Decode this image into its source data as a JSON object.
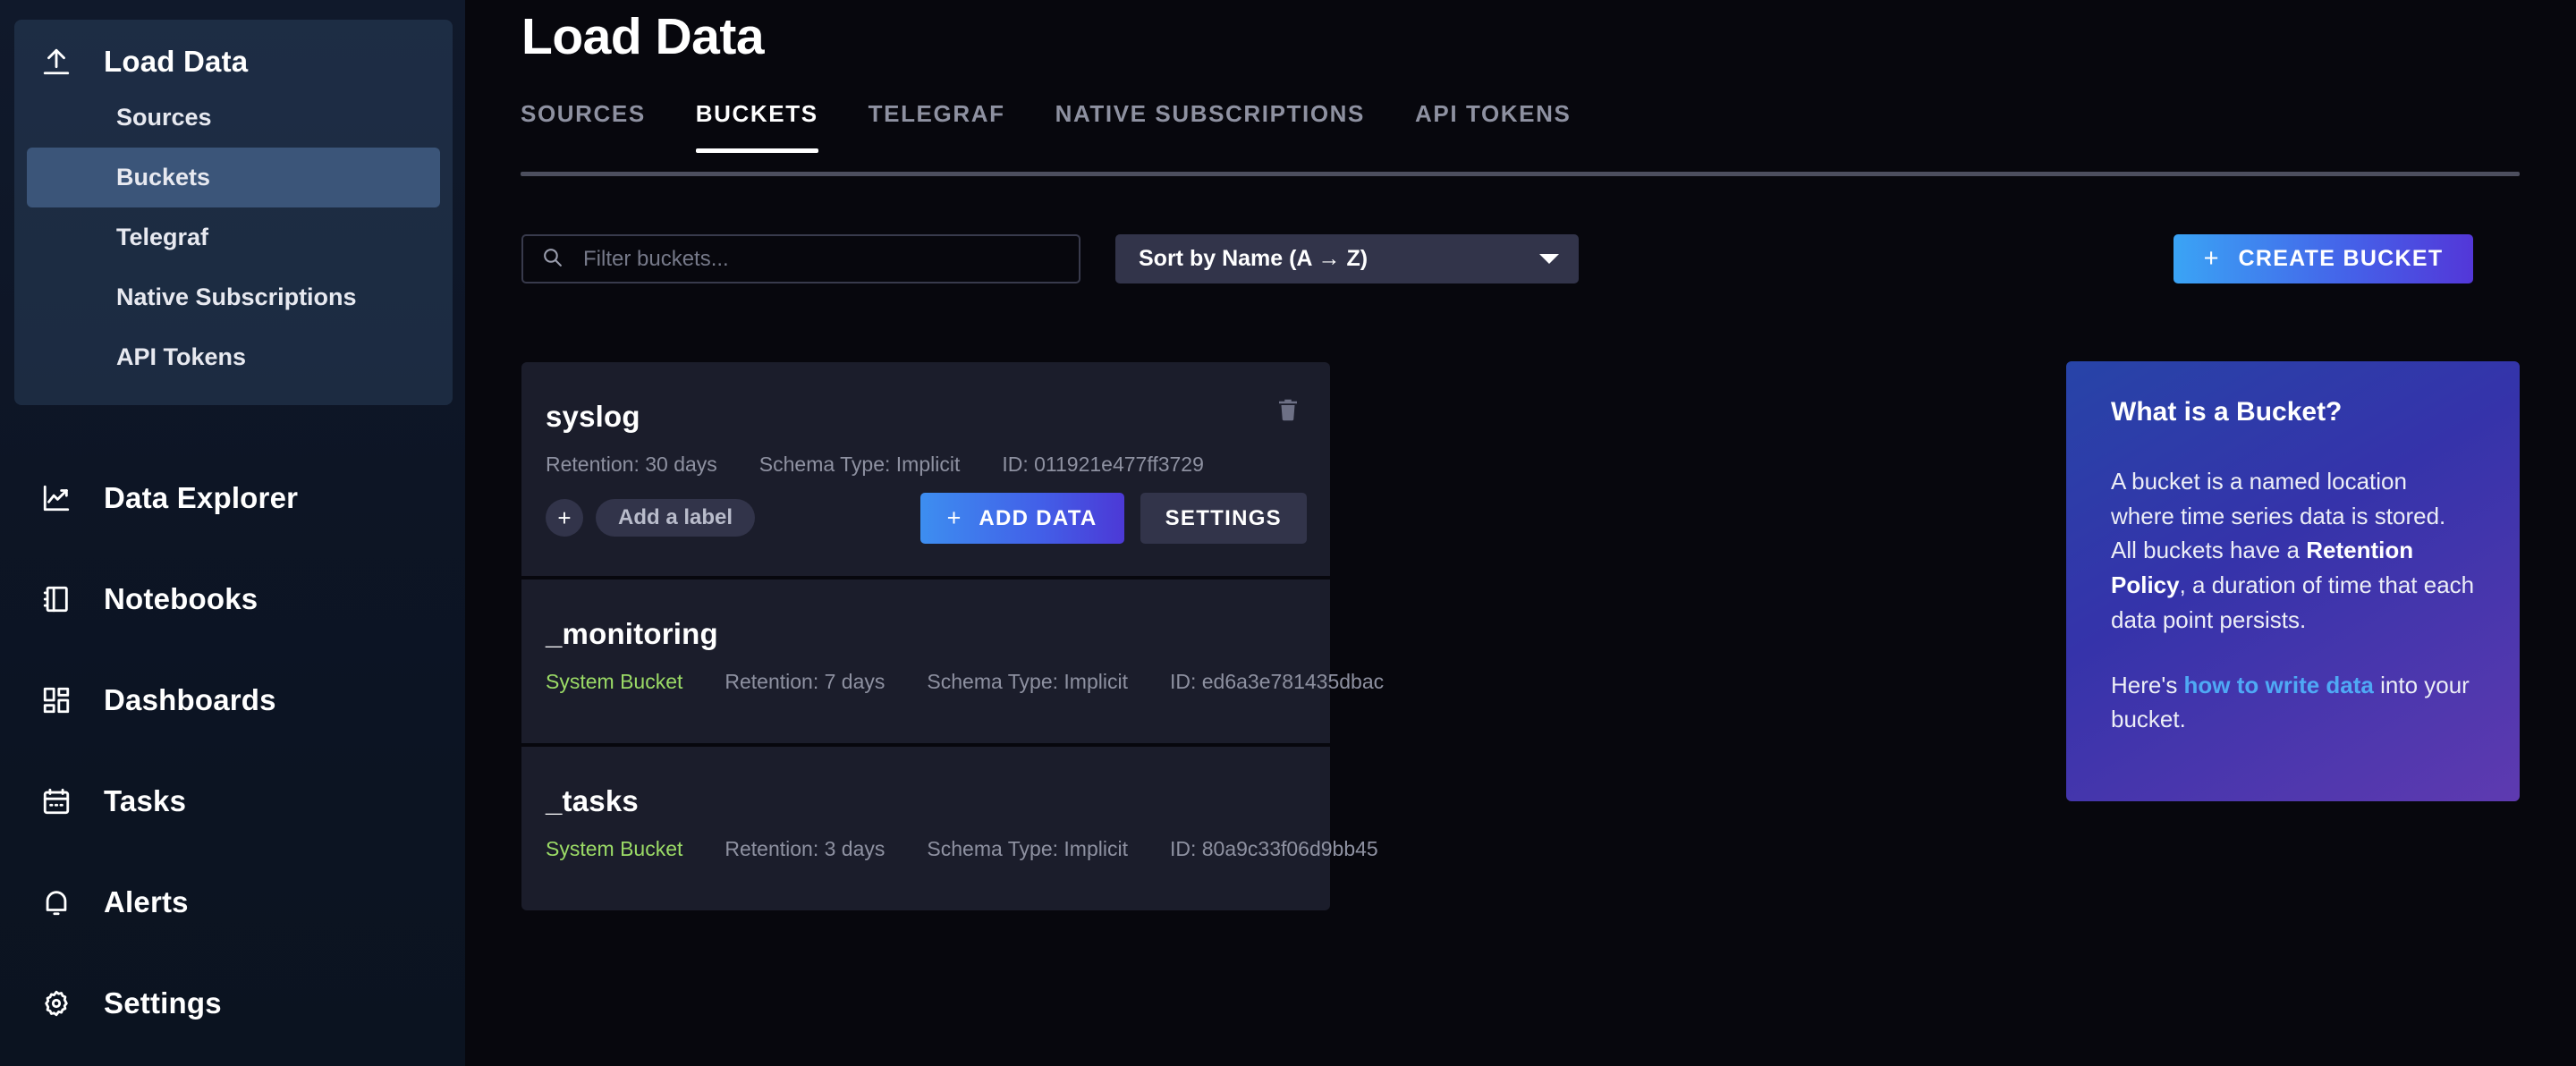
{
  "sidebar": {
    "section": {
      "label": "Load Data",
      "icon": "upload-icon",
      "items": [
        {
          "label": "Sources",
          "active": false
        },
        {
          "label": "Buckets",
          "active": true
        },
        {
          "label": "Telegraf",
          "active": false
        },
        {
          "label": "Native Subscriptions",
          "active": false
        },
        {
          "label": "API Tokens",
          "active": false
        }
      ]
    },
    "nav": [
      {
        "label": "Data Explorer",
        "icon": "line-chart-icon"
      },
      {
        "label": "Notebooks",
        "icon": "notebook-icon"
      },
      {
        "label": "Dashboards",
        "icon": "dashboard-grid-icon"
      },
      {
        "label": "Tasks",
        "icon": "calendar-icon"
      },
      {
        "label": "Alerts",
        "icon": "bell-icon"
      },
      {
        "label": "Settings",
        "icon": "gear-icon"
      }
    ]
  },
  "header": {
    "title": "Load Data",
    "tabs": [
      {
        "label": "SOURCES",
        "active": false
      },
      {
        "label": "BUCKETS",
        "active": true
      },
      {
        "label": "TELEGRAF",
        "active": false
      },
      {
        "label": "NATIVE SUBSCRIPTIONS",
        "active": false
      },
      {
        "label": "API TOKENS",
        "active": false
      }
    ]
  },
  "toolbar": {
    "filter_placeholder": "Filter buckets...",
    "filter_value": "",
    "filter_icon": "search-icon",
    "sort_label": "Sort by Name (A → Z)",
    "sort_caret_icon": "chevron-down-icon",
    "create_bucket_label": "CREATE BUCKET",
    "create_bucket_plus": "+"
  },
  "buckets": [
    {
      "name": "syslog",
      "system_badge": "",
      "retention": "Retention: 30 days",
      "schema": "Schema Type: Implicit",
      "id": "ID: 011921e477ff3729",
      "has_actions": true,
      "add_label_text": "Add a label",
      "add_label_plus": "+",
      "add_data_label": "ADD DATA",
      "add_data_plus": "+",
      "settings_label": "SETTINGS",
      "delete_icon": "trash-icon"
    },
    {
      "name": "_monitoring",
      "system_badge": "System Bucket",
      "retention": "Retention: 7 days",
      "schema": "Schema Type: Implicit",
      "id": "ID: ed6a3e781435dbac",
      "has_actions": false
    },
    {
      "name": "_tasks",
      "system_badge": "System Bucket",
      "retention": "Retention: 3 days",
      "schema": "Schema Type: Implicit",
      "id": "ID: 80a9c33f06d9bb45",
      "has_actions": false
    }
  ],
  "info_panel": {
    "title": "What is a Bucket?",
    "p1_a": "A bucket is a named location where time series data is stored. All buckets have a ",
    "p1_b": "Retention Policy",
    "p1_c": ", a duration of time that each data point persists.",
    "p2_a": "Here's ",
    "p2_link": "how to write data",
    "p2_b": " into your bucket."
  },
  "colors": {
    "accent_blue": "#3aa4f5",
    "accent_purple": "#5337d8",
    "system_badge_green": "#9bdb66",
    "link_blue": "#4fa9f5",
    "page_bg": "#07070d",
    "card_bg": "#1b1d2b"
  }
}
